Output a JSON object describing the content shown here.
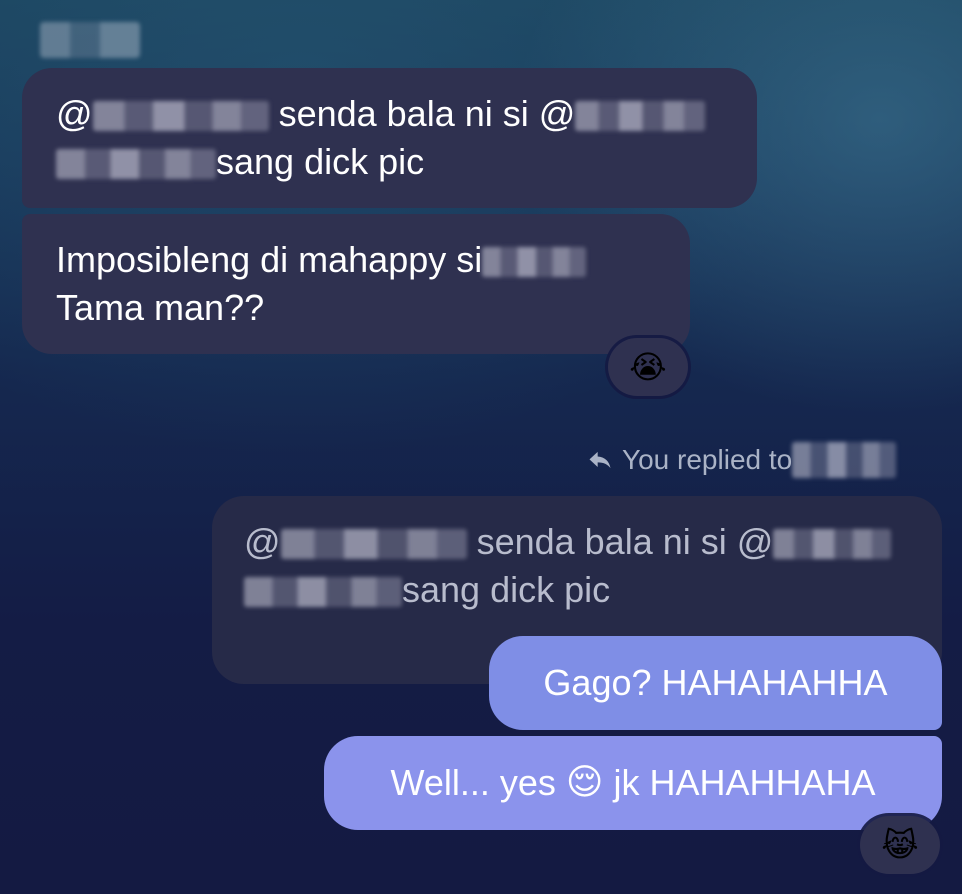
{
  "messages_in": [
    {
      "mention_prefix": "@",
      "text_a": "senda bala ni si @",
      "text_b": "sang dick pic"
    },
    {
      "text_a": "Imposibleng di mahappy si",
      "text_b": "Tama man??",
      "reaction": "😭"
    }
  ],
  "reply_context": {
    "label": "You replied to"
  },
  "quoted": {
    "mention_prefix": "@",
    "text_a": "senda bala ni si @",
    "text_b": "sang dick pic"
  },
  "messages_out": [
    {
      "text": "Gago? HAHAHAHHA"
    },
    {
      "text_a": "Well... yes ",
      "emoji": "😌",
      "text_b": " jk HAHAHHAHA",
      "reaction": "😹"
    }
  ],
  "colors": {
    "incoming_bubble": "#2f3150",
    "quoted_bubble": "#262a48",
    "outgoing_bubble": "#8291e8"
  }
}
